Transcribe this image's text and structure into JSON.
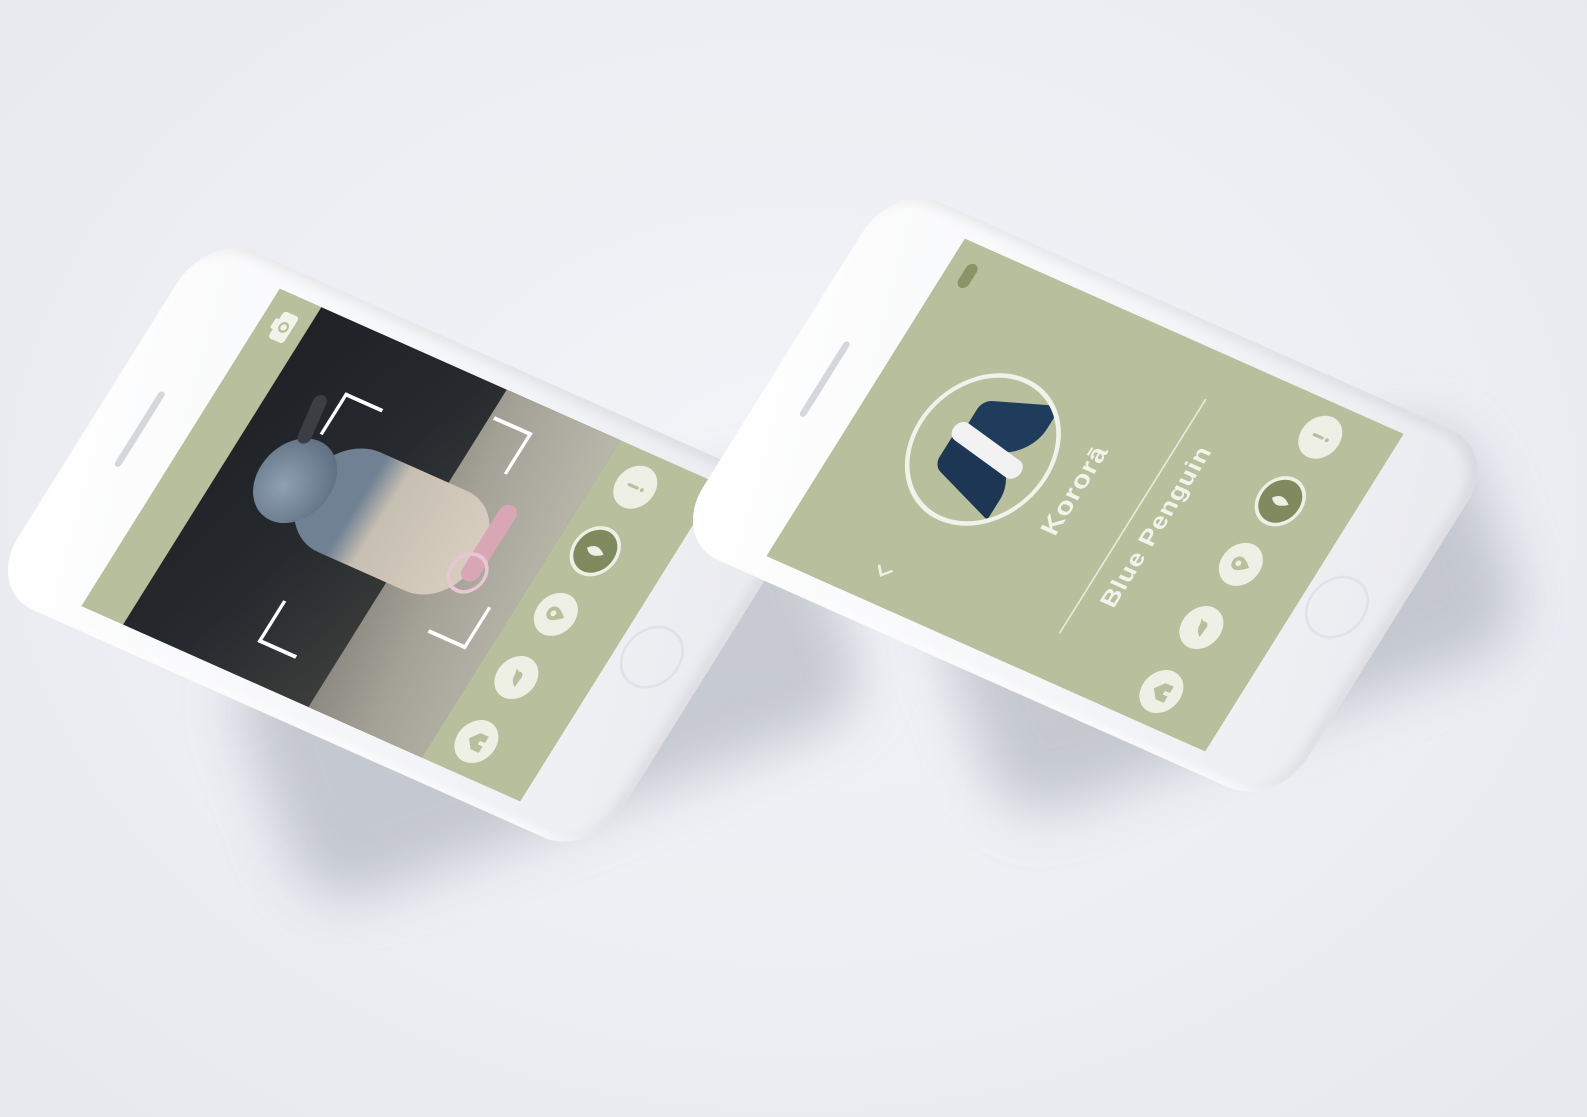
{
  "scan_screen": {
    "nav": [
      {
        "icon": "home-icon",
        "label": "",
        "active": false
      },
      {
        "icon": "penguin-silhouette-icon",
        "label": "",
        "active": false
      },
      {
        "icon": "map-pin-icon",
        "label": "",
        "active": false
      },
      {
        "icon": "leaf-icon",
        "label": "",
        "active": true
      },
      {
        "icon": "info-icon",
        "label": "",
        "active": false
      }
    ]
  },
  "info_screen": {
    "badge": "",
    "maori_name": "Kororā",
    "maori_description": "",
    "english_name": "Blue Penguin",
    "english_description": "",
    "nav": [
      {
        "icon": "home-icon",
        "label": "",
        "active": false
      },
      {
        "icon": "penguin-silhouette-icon",
        "label": "",
        "active": false
      },
      {
        "icon": "map-pin-icon",
        "label": "",
        "active": false
      },
      {
        "icon": "leaf-icon",
        "label": "",
        "active": true
      },
      {
        "icon": "info-icon",
        "label": "",
        "active": false
      }
    ]
  },
  "colors": {
    "screen_green": "#b7bf9c",
    "active_green": "#7f8a5f",
    "badge_green": "#8b9467",
    "penguin_blue": "#1c3653",
    "focus_pink": "#e9c6d2"
  }
}
